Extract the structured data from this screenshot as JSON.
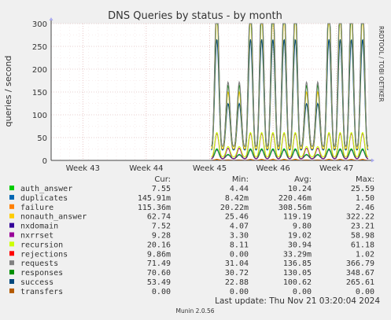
{
  "chart_data": {
    "type": "line",
    "title": "DNS Queries by status - by month",
    "ylabel": "queries / second",
    "xlabel": "",
    "ylim": [
      0,
      300
    ],
    "yticks": [
      0,
      50,
      100,
      150,
      200,
      250,
      300
    ],
    "xticks": [
      "Week 43",
      "Week 44",
      "Week 45",
      "Week 46",
      "Week 47"
    ],
    "grid": true,
    "watermark": "RRDTOOL / TOBI OETIKER",
    "data_start_fraction": 0.505,
    "cycles": 14,
    "series": [
      {
        "name": "auth_answer",
        "color": "#00cc00",
        "low": 4.44,
        "high": 25.59,
        "avg": 10.24
      },
      {
        "name": "duplicates",
        "color": "#0066b3",
        "low": 0.00842,
        "high": 1.5,
        "avg": 0.22046
      },
      {
        "name": "failure",
        "color": "#ff8000",
        "low": 0.02022,
        "high": 2.46,
        "avg": 0.30856
      },
      {
        "name": "nonauth_answer",
        "color": "#ffcc00",
        "low": 25.46,
        "high": 322.22,
        "avg": 119.19
      },
      {
        "name": "nxdomain",
        "color": "#330099",
        "low": 4.07,
        "high": 23.21,
        "avg": 9.8
      },
      {
        "name": "nxrrset",
        "color": "#990099",
        "low": 3.3,
        "high": 58.98,
        "avg": 19.02
      },
      {
        "name": "recursion",
        "color": "#ccff00",
        "low": 8.11,
        "high": 61.18,
        "avg": 30.94
      },
      {
        "name": "rejections",
        "color": "#ff0000",
        "low": 0.0,
        "high": 1.02,
        "avg": 0.03329
      },
      {
        "name": "requests",
        "color": "#808080",
        "low": 31.04,
        "high": 366.79,
        "avg": 136.85
      },
      {
        "name": "responses",
        "color": "#008f00",
        "low": 30.72,
        "high": 348.67,
        "avg": 130.05
      },
      {
        "name": "success",
        "color": "#00487d",
        "low": 22.88,
        "high": 265.61,
        "avg": 100.62
      },
      {
        "name": "transfers",
        "color": "#b35a00",
        "low": 0.0,
        "high": 0.0,
        "avg": 0.0
      }
    ]
  },
  "legend": {
    "headers": {
      "cur": "Cur:",
      "min": "Min:",
      "avg": "Avg:",
      "max": "Max:"
    },
    "rows": [
      {
        "name": "auth_answer",
        "color": "#00cc00",
        "cur": "7.55",
        "min": "4.44",
        "avg": "10.24",
        "max": "25.59"
      },
      {
        "name": "duplicates",
        "color": "#0066b3",
        "cur": "145.91m",
        "min": "8.42m",
        "avg": "220.46m",
        "max": "1.50"
      },
      {
        "name": "failure",
        "color": "#ff8000",
        "cur": "115.36m",
        "min": "20.22m",
        "avg": "308.56m",
        "max": "2.46"
      },
      {
        "name": "nonauth_answer",
        "color": "#ffcc00",
        "cur": "62.74",
        "min": "25.46",
        "avg": "119.19",
        "max": "322.22"
      },
      {
        "name": "nxdomain",
        "color": "#330099",
        "cur": "7.52",
        "min": "4.07",
        "avg": "9.80",
        "max": "23.21"
      },
      {
        "name": "nxrrset",
        "color": "#990099",
        "cur": "9.28",
        "min": "3.30",
        "avg": "19.02",
        "max": "58.98"
      },
      {
        "name": "recursion",
        "color": "#ccff00",
        "cur": "20.16",
        "min": "8.11",
        "avg": "30.94",
        "max": "61.18"
      },
      {
        "name": "rejections",
        "color": "#ff0000",
        "cur": "9.86m",
        "min": "0.00",
        "avg": "33.29m",
        "max": "1.02"
      },
      {
        "name": "requests",
        "color": "#808080",
        "cur": "71.49",
        "min": "31.04",
        "avg": "136.85",
        "max": "366.79"
      },
      {
        "name": "responses",
        "color": "#008f00",
        "cur": "70.60",
        "min": "30.72",
        "avg": "130.05",
        "max": "348.67"
      },
      {
        "name": "success",
        "color": "#00487d",
        "cur": "53.49",
        "min": "22.88",
        "avg": "100.62",
        "max": "265.61"
      },
      {
        "name": "transfers",
        "color": "#b35a00",
        "cur": "0.00",
        "min": "0.00",
        "avg": "0.00",
        "max": "0.00"
      }
    ]
  },
  "footer": {
    "last_update": "Last update: Thu Nov 21 03:20:04 2024",
    "munin": "Munin 2.0.56"
  }
}
